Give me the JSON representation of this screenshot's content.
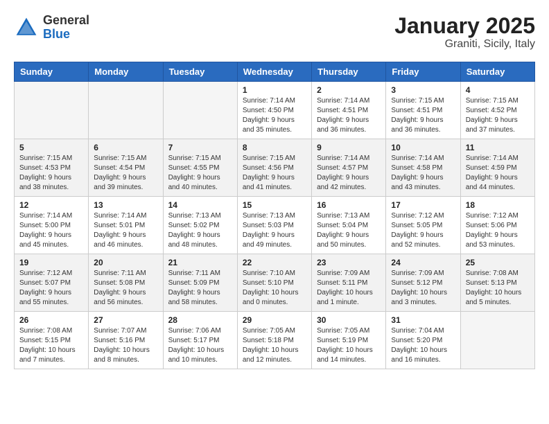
{
  "header": {
    "logo_general": "General",
    "logo_blue": "Blue",
    "title": "January 2025",
    "subtitle": "Graniti, Sicily, Italy"
  },
  "days_of_week": [
    "Sunday",
    "Monday",
    "Tuesday",
    "Wednesday",
    "Thursday",
    "Friday",
    "Saturday"
  ],
  "weeks": [
    [
      {
        "day": "",
        "info": ""
      },
      {
        "day": "",
        "info": ""
      },
      {
        "day": "",
        "info": ""
      },
      {
        "day": "1",
        "info": "Sunrise: 7:14 AM\nSunset: 4:50 PM\nDaylight: 9 hours\nand 35 minutes."
      },
      {
        "day": "2",
        "info": "Sunrise: 7:14 AM\nSunset: 4:51 PM\nDaylight: 9 hours\nand 36 minutes."
      },
      {
        "day": "3",
        "info": "Sunrise: 7:15 AM\nSunset: 4:51 PM\nDaylight: 9 hours\nand 36 minutes."
      },
      {
        "day": "4",
        "info": "Sunrise: 7:15 AM\nSunset: 4:52 PM\nDaylight: 9 hours\nand 37 minutes."
      }
    ],
    [
      {
        "day": "5",
        "info": "Sunrise: 7:15 AM\nSunset: 4:53 PM\nDaylight: 9 hours\nand 38 minutes."
      },
      {
        "day": "6",
        "info": "Sunrise: 7:15 AM\nSunset: 4:54 PM\nDaylight: 9 hours\nand 39 minutes."
      },
      {
        "day": "7",
        "info": "Sunrise: 7:15 AM\nSunset: 4:55 PM\nDaylight: 9 hours\nand 40 minutes."
      },
      {
        "day": "8",
        "info": "Sunrise: 7:15 AM\nSunset: 4:56 PM\nDaylight: 9 hours\nand 41 minutes."
      },
      {
        "day": "9",
        "info": "Sunrise: 7:14 AM\nSunset: 4:57 PM\nDaylight: 9 hours\nand 42 minutes."
      },
      {
        "day": "10",
        "info": "Sunrise: 7:14 AM\nSunset: 4:58 PM\nDaylight: 9 hours\nand 43 minutes."
      },
      {
        "day": "11",
        "info": "Sunrise: 7:14 AM\nSunset: 4:59 PM\nDaylight: 9 hours\nand 44 minutes."
      }
    ],
    [
      {
        "day": "12",
        "info": "Sunrise: 7:14 AM\nSunset: 5:00 PM\nDaylight: 9 hours\nand 45 minutes."
      },
      {
        "day": "13",
        "info": "Sunrise: 7:14 AM\nSunset: 5:01 PM\nDaylight: 9 hours\nand 46 minutes."
      },
      {
        "day": "14",
        "info": "Sunrise: 7:13 AM\nSunset: 5:02 PM\nDaylight: 9 hours\nand 48 minutes."
      },
      {
        "day": "15",
        "info": "Sunrise: 7:13 AM\nSunset: 5:03 PM\nDaylight: 9 hours\nand 49 minutes."
      },
      {
        "day": "16",
        "info": "Sunrise: 7:13 AM\nSunset: 5:04 PM\nDaylight: 9 hours\nand 50 minutes."
      },
      {
        "day": "17",
        "info": "Sunrise: 7:12 AM\nSunset: 5:05 PM\nDaylight: 9 hours\nand 52 minutes."
      },
      {
        "day": "18",
        "info": "Sunrise: 7:12 AM\nSunset: 5:06 PM\nDaylight: 9 hours\nand 53 minutes."
      }
    ],
    [
      {
        "day": "19",
        "info": "Sunrise: 7:12 AM\nSunset: 5:07 PM\nDaylight: 9 hours\nand 55 minutes."
      },
      {
        "day": "20",
        "info": "Sunrise: 7:11 AM\nSunset: 5:08 PM\nDaylight: 9 hours\nand 56 minutes."
      },
      {
        "day": "21",
        "info": "Sunrise: 7:11 AM\nSunset: 5:09 PM\nDaylight: 9 hours\nand 58 minutes."
      },
      {
        "day": "22",
        "info": "Sunrise: 7:10 AM\nSunset: 5:10 PM\nDaylight: 10 hours\nand 0 minutes."
      },
      {
        "day": "23",
        "info": "Sunrise: 7:09 AM\nSunset: 5:11 PM\nDaylight: 10 hours\nand 1 minute."
      },
      {
        "day": "24",
        "info": "Sunrise: 7:09 AM\nSunset: 5:12 PM\nDaylight: 10 hours\nand 3 minutes."
      },
      {
        "day": "25",
        "info": "Sunrise: 7:08 AM\nSunset: 5:13 PM\nDaylight: 10 hours\nand 5 minutes."
      }
    ],
    [
      {
        "day": "26",
        "info": "Sunrise: 7:08 AM\nSunset: 5:15 PM\nDaylight: 10 hours\nand 7 minutes."
      },
      {
        "day": "27",
        "info": "Sunrise: 7:07 AM\nSunset: 5:16 PM\nDaylight: 10 hours\nand 8 minutes."
      },
      {
        "day": "28",
        "info": "Sunrise: 7:06 AM\nSunset: 5:17 PM\nDaylight: 10 hours\nand 10 minutes."
      },
      {
        "day": "29",
        "info": "Sunrise: 7:05 AM\nSunset: 5:18 PM\nDaylight: 10 hours\nand 12 minutes."
      },
      {
        "day": "30",
        "info": "Sunrise: 7:05 AM\nSunset: 5:19 PM\nDaylight: 10 hours\nand 14 minutes."
      },
      {
        "day": "31",
        "info": "Sunrise: 7:04 AM\nSunset: 5:20 PM\nDaylight: 10 hours\nand 16 minutes."
      },
      {
        "day": "",
        "info": ""
      }
    ]
  ]
}
